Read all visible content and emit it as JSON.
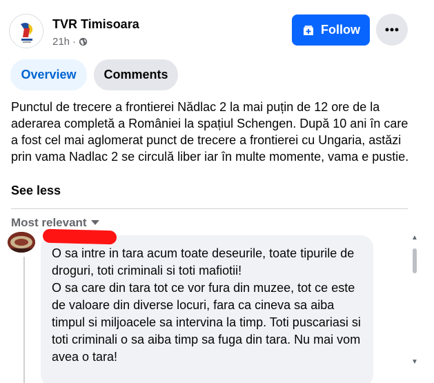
{
  "header": {
    "page_name": "TVR Timisoara",
    "time": "21h",
    "separator": "·",
    "privacy_icon": "globe-icon",
    "follow_label": "Follow",
    "follow_icon": "follow-page-icon",
    "more_icon": "more-icon"
  },
  "tabs": [
    {
      "label": "Overview",
      "active": true
    },
    {
      "label": "Comments",
      "active": false
    }
  ],
  "post": {
    "text": "Punctul de trecere a frontierei Nădlac 2 la mai puțin de 12 ore de la aderarea completă a României la spațiul Schengen. După 10 ani în care a fost cel mai aglomerat punct de trecere a frontierei cu Ungaria, astăzi prin vama Nadlac 2 se circulă liber iar în multe momente, vama e pustie.",
    "see_less_label": "See less"
  },
  "comments_section": {
    "sort_label": "Most relevant",
    "sort_icon": "caret-down-icon"
  },
  "comment": {
    "text_line1": "O sa intre in tara acum toate deseurile, toate tipurile de droguri, toti criminali si toti mafiotii!",
    "text_line2": "O sa care din tara tot ce vor fura din muzee, tot ce este de valoare din diverse locuri, fara ca cineva sa aiba timpul si miljoacele sa intervina la timp. Toti puscariasi si toti criminali o sa aiba timp sa fuga din tara. Nu mai vom avea o tara!"
  },
  "colors": {
    "accent": "#0866ff",
    "active_tab_bg": "#ebf5ff",
    "active_tab_text": "#0064d1",
    "secondary_text": "#65676b",
    "bubble_bg": "#f0f2f5",
    "redaction": "#ff1414"
  }
}
